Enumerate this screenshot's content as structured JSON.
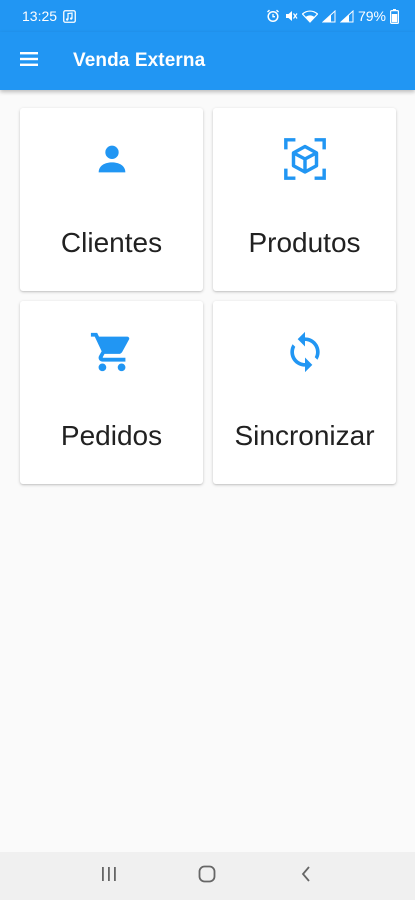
{
  "status_bar": {
    "time": "13:25",
    "battery": "79%"
  },
  "app_bar": {
    "title": "Venda Externa",
    "menu_icon": "menu-icon"
  },
  "colors": {
    "primary": "#2196f3",
    "background": "#fafafa",
    "card": "#ffffff",
    "text": "#212121"
  },
  "menu": {
    "items": [
      {
        "label": "Clientes",
        "icon": "person-icon"
      },
      {
        "label": "Produtos",
        "icon": "cube-scan-icon"
      },
      {
        "label": "Pedidos",
        "icon": "shopping-cart-icon"
      },
      {
        "label": "Sincronizar",
        "icon": "sync-icon"
      }
    ]
  },
  "nav_bar": {
    "buttons": [
      "recent-apps-icon",
      "home-icon",
      "back-icon"
    ]
  }
}
